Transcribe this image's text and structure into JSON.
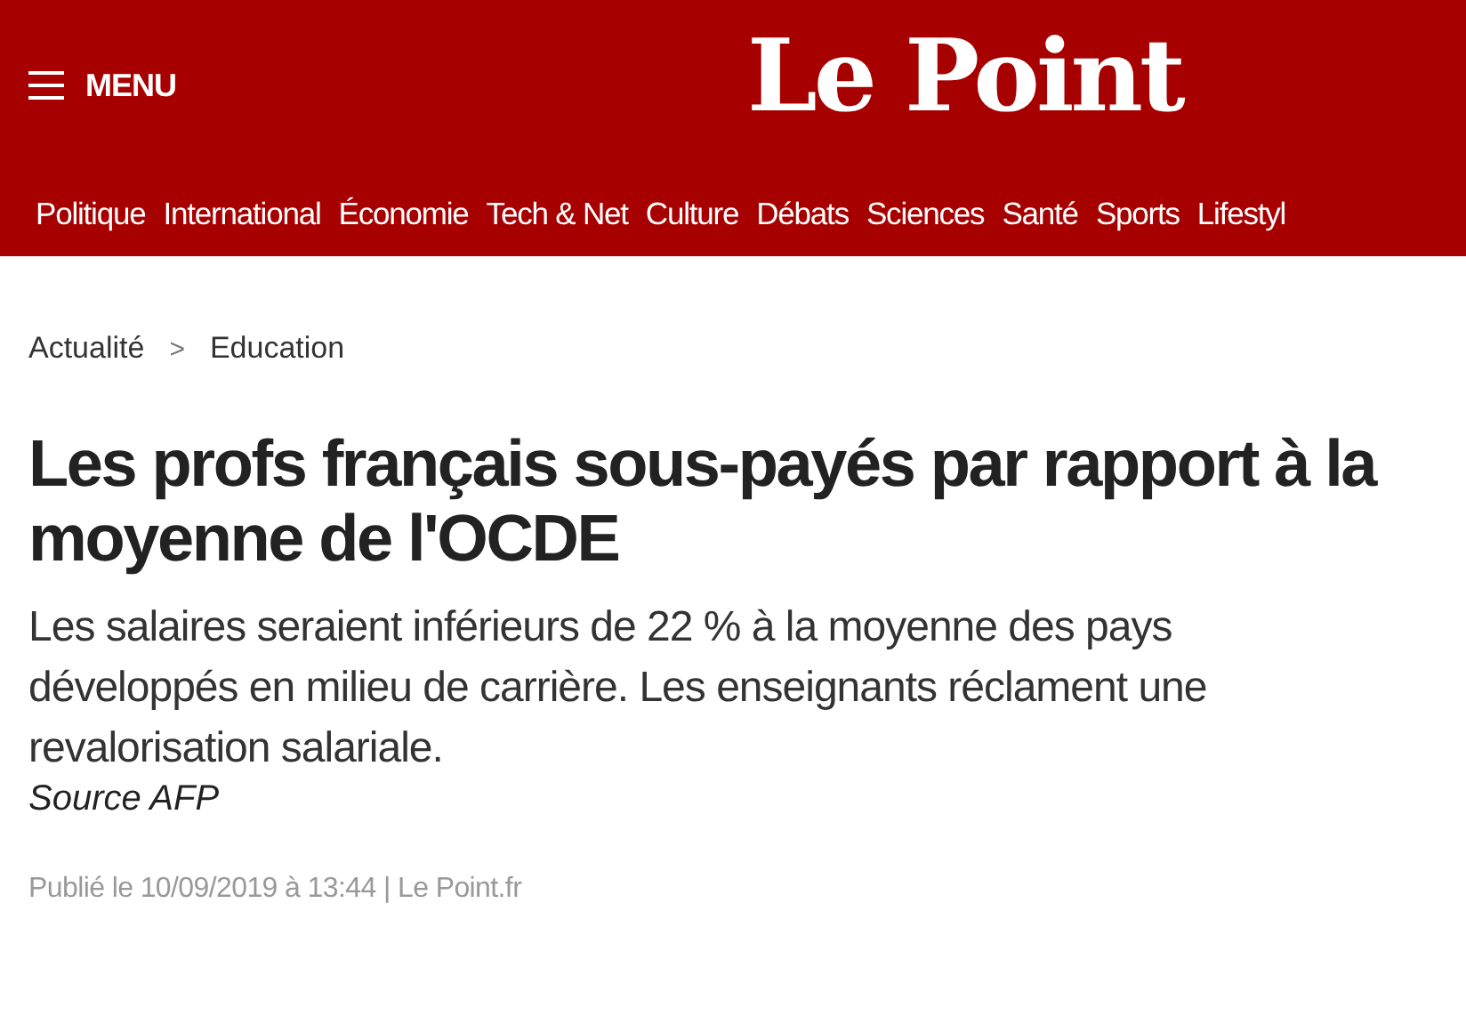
{
  "header": {
    "menu_label": "MENU",
    "logo": "Le Point"
  },
  "nav": [
    "Politique",
    "International",
    "Économie",
    "Tech & Net",
    "Culture",
    "Débats",
    "Sciences",
    "Santé",
    "Sports",
    "Lifestyl"
  ],
  "breadcrumb": {
    "items": [
      "Actualité",
      "Education"
    ],
    "separator": ">"
  },
  "article": {
    "headline": "Les profs français sous-payés par rapport à la moyenne de l'OCDE",
    "lead": "Les salaires seraient inférieurs de 22 % à la moyenne des pays développés en milieu de carrière. Les enseignants réclament une revalorisation salariale.",
    "source": "Source AFP",
    "published": "Publié le 10/09/2019 à 13:44 | Le Point.fr"
  }
}
